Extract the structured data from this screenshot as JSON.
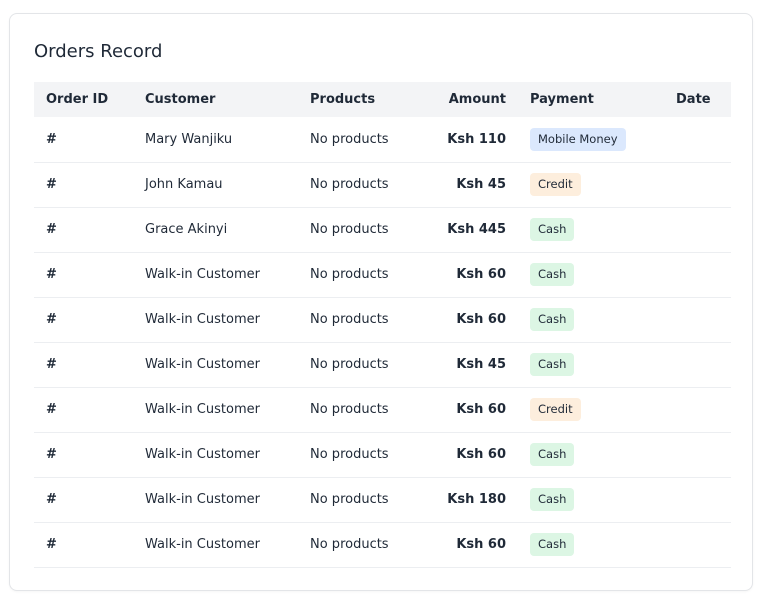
{
  "card": {
    "title": "Orders Record"
  },
  "table": {
    "headers": {
      "order_id": "Order ID",
      "customer": "Customer",
      "products": "Products",
      "amount": "Amount",
      "payment": "Payment",
      "date": "Date"
    },
    "rows": [
      {
        "order_id": "#",
        "customer": "Mary Wanjiku",
        "products": "No products",
        "amount": "Ksh 110",
        "payment": "Mobile Money",
        "payment_type": "mobile",
        "date": ""
      },
      {
        "order_id": "#",
        "customer": "John Kamau",
        "products": "No products",
        "amount": "Ksh 45",
        "payment": "Credit",
        "payment_type": "credit",
        "date": ""
      },
      {
        "order_id": "#",
        "customer": "Grace Akinyi",
        "products": "No products",
        "amount": "Ksh 445",
        "payment": "Cash",
        "payment_type": "cash",
        "date": ""
      },
      {
        "order_id": "#",
        "customer": "Walk-in Customer",
        "products": "No products",
        "amount": "Ksh 60",
        "payment": "Cash",
        "payment_type": "cash",
        "date": ""
      },
      {
        "order_id": "#",
        "customer": "Walk-in Customer",
        "products": "No products",
        "amount": "Ksh 60",
        "payment": "Cash",
        "payment_type": "cash",
        "date": ""
      },
      {
        "order_id": "#",
        "customer": "Walk-in Customer",
        "products": "No products",
        "amount": "Ksh 45",
        "payment": "Cash",
        "payment_type": "cash",
        "date": ""
      },
      {
        "order_id": "#",
        "customer": "Walk-in Customer",
        "products": "No products",
        "amount": "Ksh 60",
        "payment": "Credit",
        "payment_type": "credit",
        "date": ""
      },
      {
        "order_id": "#",
        "customer": "Walk-in Customer",
        "products": "No products",
        "amount": "Ksh 60",
        "payment": "Cash",
        "payment_type": "cash",
        "date": ""
      },
      {
        "order_id": "#",
        "customer": "Walk-in Customer",
        "products": "No products",
        "amount": "Ksh 180",
        "payment": "Cash",
        "payment_type": "cash",
        "date": ""
      },
      {
        "order_id": "#",
        "customer": "Walk-in Customer",
        "products": "No products",
        "amount": "Ksh 60",
        "payment": "Cash",
        "payment_type": "cash",
        "date": ""
      }
    ]
  },
  "colors": {
    "header_bg": "#f3f4f6",
    "badge_mobile": "#dbe8fd",
    "badge_credit": "#fdeedd",
    "badge_cash": "#dcf6e4"
  }
}
